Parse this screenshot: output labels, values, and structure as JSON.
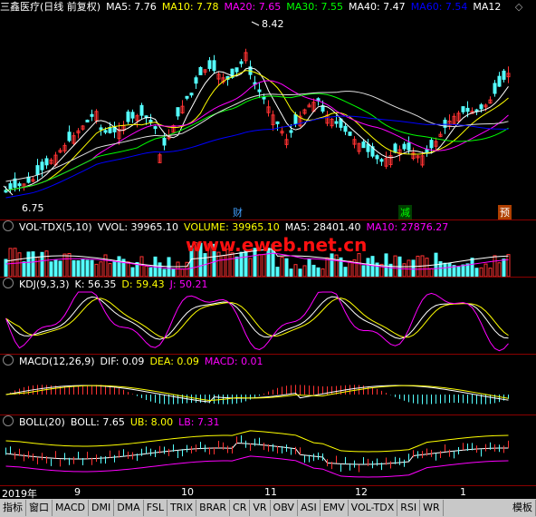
{
  "main": {
    "title": "三鑫医疗(日线 前复权)",
    "ma": [
      {
        "label": "MA5: 7.76",
        "color": "#ffffff"
      },
      {
        "label": "MA10: 7.78",
        "color": "#ffff00"
      },
      {
        "label": "MA20: 7.65",
        "color": "#ff00ff"
      },
      {
        "label": "MA30: 7.55",
        "color": "#00ff00"
      },
      {
        "label": "MA40: 7.47",
        "color": "#ffffff"
      },
      {
        "label": "MA60: 7.54",
        "color": "#0000ff"
      },
      {
        "label": "MA12",
        "color": "#ffffff"
      }
    ],
    "high_label": "8.42",
    "low_label": "6.75",
    "markers": [
      {
        "text": "财",
        "color": "#40a0ff"
      },
      {
        "text": "减",
        "color": "#00ff00"
      },
      {
        "text": "预",
        "color": "#ffffff"
      }
    ]
  },
  "vol": {
    "name": "VOL-TDX(5,10)",
    "vvol": "VVOL: 39965.10",
    "volume": "VOLUME: 39965.10",
    "ma5": "MA5: 28401.40",
    "ma10": "MA10: 27876.27",
    "colors": {
      "vvol": "#ffffff",
      "volume": "#ffff00",
      "ma5": "#ffffff",
      "ma10": "#ff00ff"
    }
  },
  "kdj": {
    "name": "KDJ(9,3,3)",
    "k": "K: 56.35",
    "d": "D: 59.43",
    "j": "J: 50.21"
  },
  "macd": {
    "name": "MACD(12,26,9)",
    "dif": "DIF: 0.09",
    "dea": "DEA: 0.09",
    "macd": "MACD: 0.01"
  },
  "boll": {
    "name": "BOLL(20)",
    "boll": "BOLL: 7.65",
    "ub": "UB: 8.00",
    "lb": "LB: 7.31"
  },
  "xaxis": [
    "2019年",
    "9",
    "10",
    "11",
    "12",
    "1"
  ],
  "watermark": "www.eweb.net.cn",
  "tabs": [
    "指标",
    "窗口",
    "MACD",
    "DMI",
    "DMA",
    "FSL",
    "TRIX",
    "BRAR",
    "CR",
    "VR",
    "OBV",
    "ASI",
    "EMV",
    "VOL-TDX",
    "RSI",
    "WR"
  ],
  "tab_right": "模板"
}
